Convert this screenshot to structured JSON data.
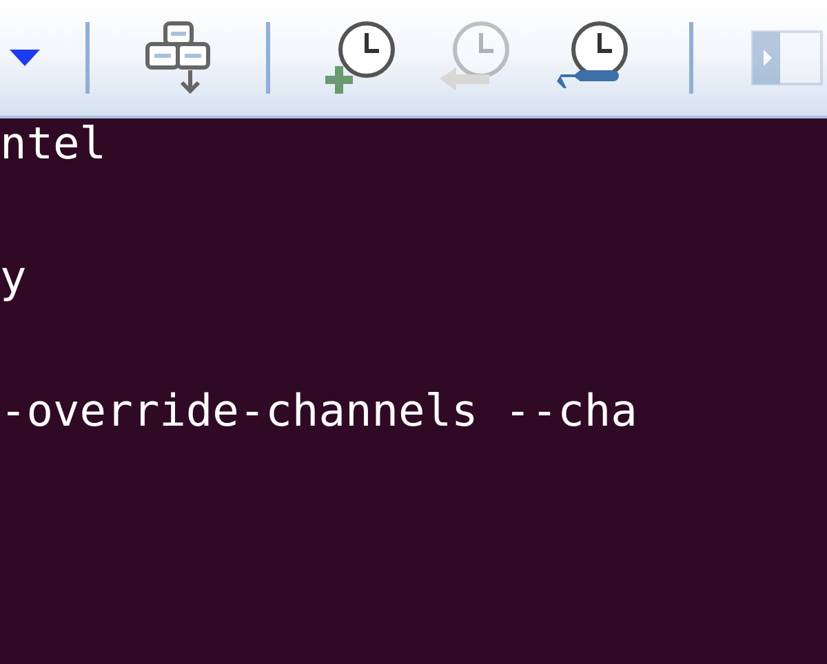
{
  "toolbar": {
    "tools": [
      {
        "kind": "dropdown",
        "disabled": false
      },
      {
        "kind": "separator"
      },
      {
        "kind": "stack",
        "disabled": false
      },
      {
        "kind": "separator"
      },
      {
        "kind": "clock-add",
        "disabled": false
      },
      {
        "kind": "clock-back",
        "disabled": true
      },
      {
        "kind": "clock-wrench",
        "disabled": false
      },
      {
        "kind": "separator"
      },
      {
        "kind": "panel",
        "disabled": true
      }
    ]
  },
  "terminal": {
    "lines": [
      "ntel",
      "y",
      "-override-channels --cha"
    ]
  }
}
